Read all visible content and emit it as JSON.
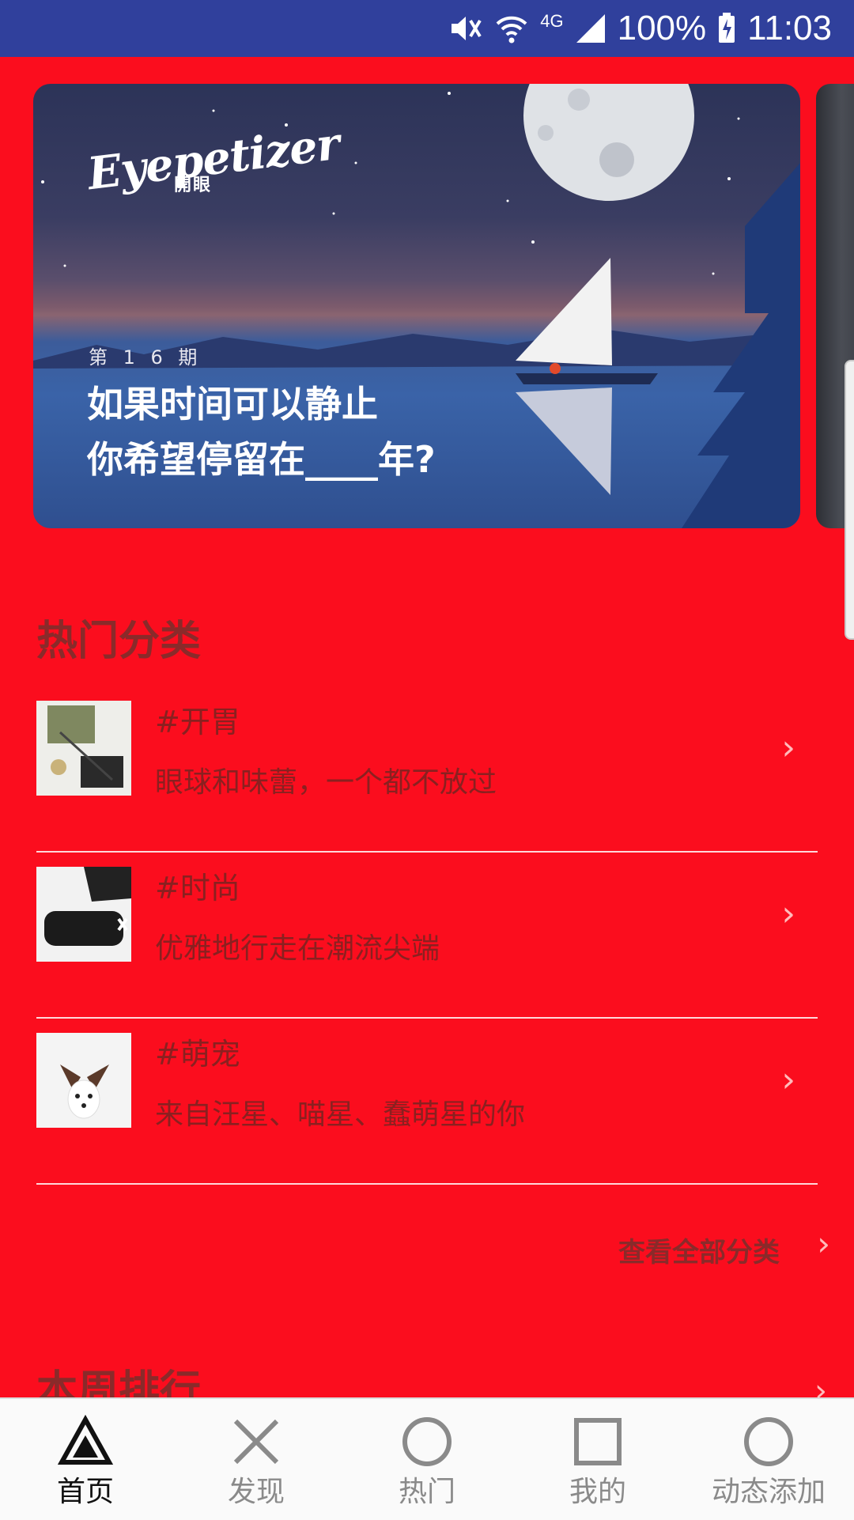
{
  "status_bar": {
    "battery": "100%",
    "time": "11:03",
    "network": "4G"
  },
  "banner": {
    "logo": "Eyepetizer",
    "logo_sub": "開眼",
    "issue": "第 1 6 期",
    "title_line1": "如果时间可以静止",
    "title_line2": "你希望停留在____年?"
  },
  "hot_categories": {
    "title": "热门分类",
    "items": [
      {
        "name": "#开胃",
        "desc": "眼球和味蕾，一个都不放过"
      },
      {
        "name": "#时尚",
        "desc": "优雅地行走在潮流尖端"
      },
      {
        "name": "#萌宠",
        "desc": "来自汪星、喵星、蠢萌星的你"
      }
    ],
    "view_all": "查看全部分类"
  },
  "weekly_rank": {
    "title": "本周排行"
  },
  "bottom_nav": {
    "items": [
      {
        "label": "首页",
        "icon": "triangle-icon",
        "active": true
      },
      {
        "label": "发现",
        "icon": "close-x-icon",
        "active": false
      },
      {
        "label": "热门",
        "icon": "circle-icon",
        "active": false
      },
      {
        "label": "我的",
        "icon": "square-icon",
        "active": false
      },
      {
        "label": "动态添加",
        "icon": "circle-icon",
        "active": false
      }
    ]
  },
  "colors": {
    "background": "#fb0d1e",
    "status_bar": "#30409c",
    "section_text": "#8a2a2a",
    "nav_background": "#fafafa"
  }
}
